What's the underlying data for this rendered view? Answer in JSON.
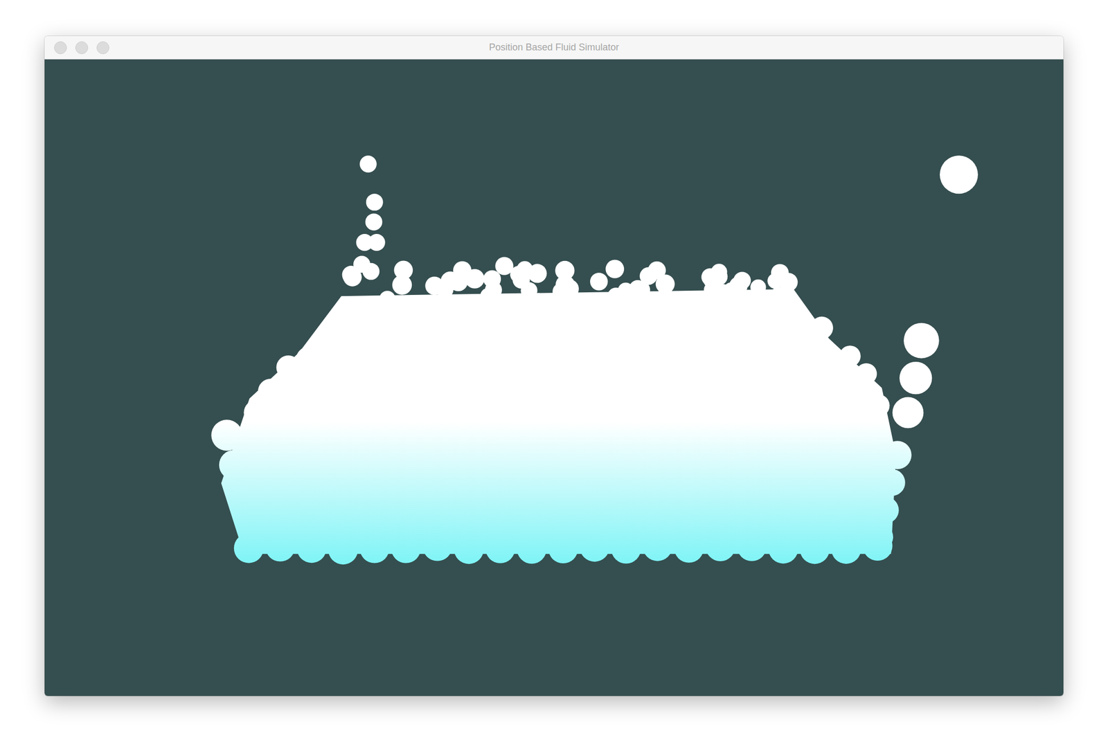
{
  "window": {
    "title": "Position Based Fluid Simulator",
    "active": false
  }
}
